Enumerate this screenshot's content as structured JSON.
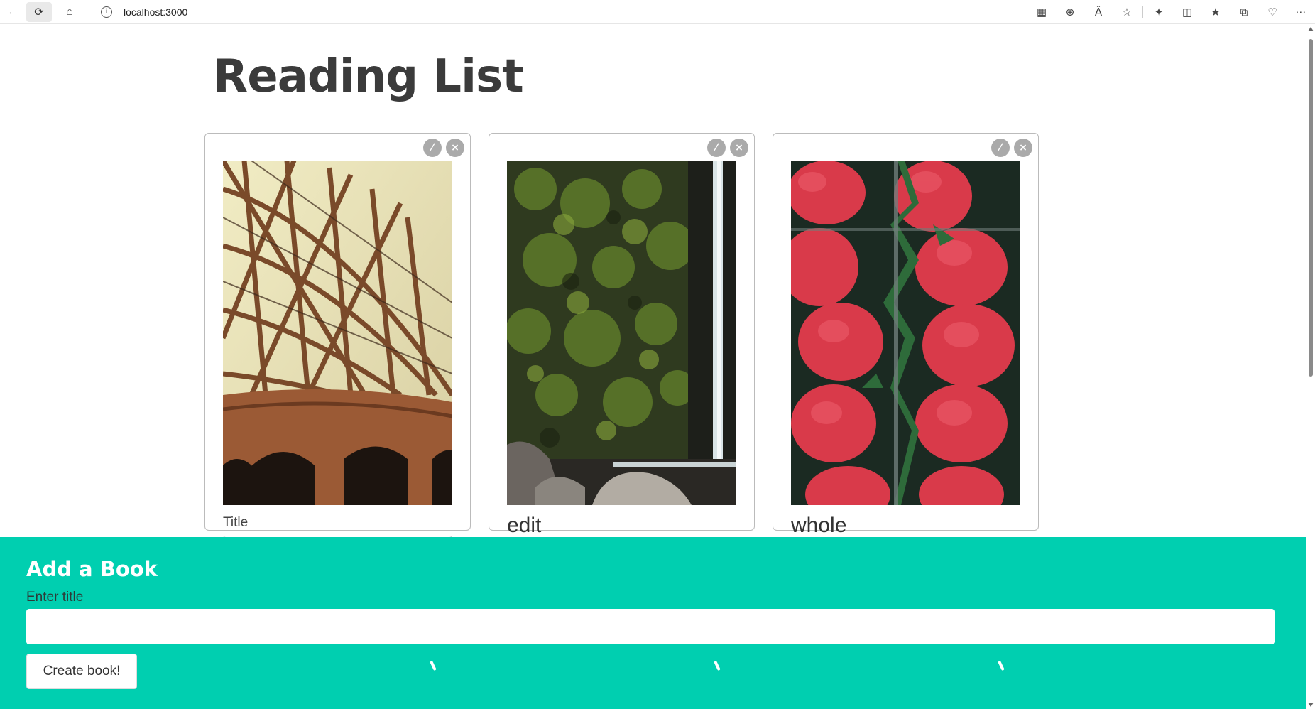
{
  "browser": {
    "url": "localhost:3000",
    "icons": [
      "back-icon",
      "reload-icon",
      "home-icon",
      "info-icon",
      "app-icon",
      "zoom-icon",
      "read-aloud-icon",
      "favorite-icon",
      "extensions-icon",
      "split-screen-icon",
      "favorites-icon",
      "collections-icon",
      "health-icon",
      "more-icon"
    ]
  },
  "page": {
    "title": "Reading List"
  },
  "cards": [
    {
      "caption": "",
      "field_label": "Title",
      "image": "bridge-photo"
    },
    {
      "caption": "edit",
      "field_label": "",
      "image": "mossy-waterfall-photo"
    },
    {
      "caption": "whole",
      "field_label": "",
      "image": "strawberries-photo"
    }
  ],
  "add_form": {
    "heading": "Add a Book",
    "label": "Enter title",
    "input_value": "",
    "button_label": "Create book!"
  },
  "colors": {
    "accent": "#00cfb0",
    "title_text": "#3b3b3b"
  }
}
